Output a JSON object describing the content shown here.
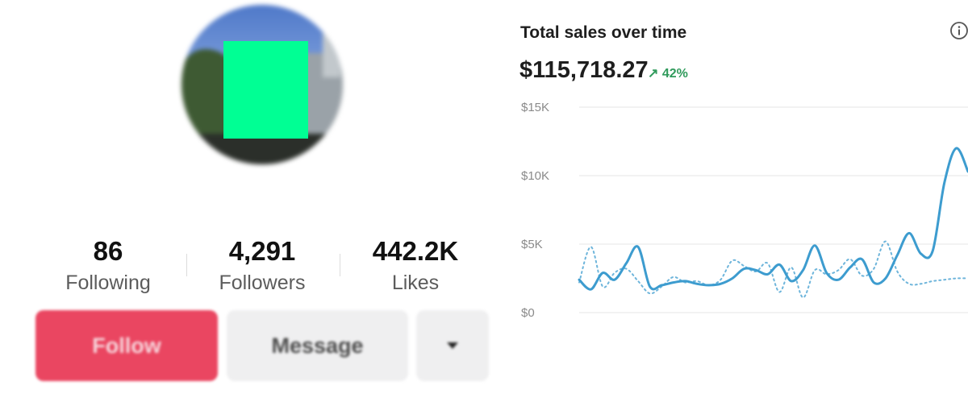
{
  "profile": {
    "stats": [
      {
        "value": "86",
        "label": "Following"
      },
      {
        "value": "4,291",
        "label": "Followers"
      },
      {
        "value": "442.2K",
        "label": "Likes"
      }
    ],
    "buttons": {
      "follow": "Follow",
      "message": "Message",
      "more_icon": "caret-down-icon"
    }
  },
  "colors": {
    "follow_button": "#ea4661",
    "chart_line": "#3d9ccf",
    "positive_change": "#2f9a5b"
  },
  "sales": {
    "title": "Total sales over time",
    "total": "$115,718.27",
    "change": "42%",
    "info_icon": "info-icon",
    "change_icon": "arrow-up-right-icon"
  },
  "chart_data": {
    "type": "line",
    "ylabels": [
      "$15K",
      "$10K",
      "$5K",
      "$0"
    ],
    "ylim": [
      0,
      15000
    ],
    "grid": true,
    "series": [
      {
        "style": "solid",
        "values": [
          2400,
          1700,
          2900,
          2400,
          3600,
          4800,
          1900,
          2000,
          2200,
          2300,
          2100,
          2000,
          2100,
          2500,
          3200,
          3100,
          2800,
          3500,
          2300,
          3100,
          4900,
          2900,
          2400,
          3300,
          3900,
          2200,
          2500,
          4200,
          5800,
          4300,
          4500,
          9500,
          12000,
          10300
        ]
      },
      {
        "style": "dotted",
        "values": [
          2200,
          4800,
          1900,
          2900,
          3200,
          2300,
          1400,
          1900,
          2600,
          2200,
          2300,
          2000,
          2400,
          3800,
          3400,
          3000,
          3600,
          1500,
          3300,
          1100,
          3100,
          2800,
          3100,
          3900,
          2700,
          3200,
          5200,
          3000,
          2100,
          2100,
          2300,
          2400,
          2500,
          2500
        ]
      }
    ]
  }
}
